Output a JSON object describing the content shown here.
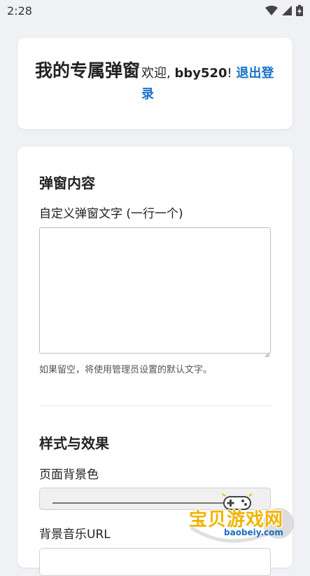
{
  "status_bar": {
    "time": "2:28",
    "icons": [
      "wifi-icon",
      "cell-signal-icon",
      "battery-charging-icon"
    ]
  },
  "header": {
    "title": "我的专属弹窗",
    "welcome_prefix": "欢迎, ",
    "username": "bby520",
    "exclaim": "! ",
    "logout_label": "退出登录"
  },
  "popup_section": {
    "title": "弹窗内容",
    "text_label": "自定义弹窗文字 (一行一个)",
    "text_value": "",
    "hint": "如果留空，将使用管理员设置的默认文字。"
  },
  "style_section": {
    "title": "样式与效果",
    "bg_color_label": "页面背景色",
    "music_url_label": "背景音乐URL"
  },
  "watermark": {
    "text": "宝贝游戏网",
    "domain": "baobeiy.com"
  },
  "colors": {
    "link": "#1a73c9",
    "background": "#f0f1f5",
    "card": "#ffffff"
  }
}
